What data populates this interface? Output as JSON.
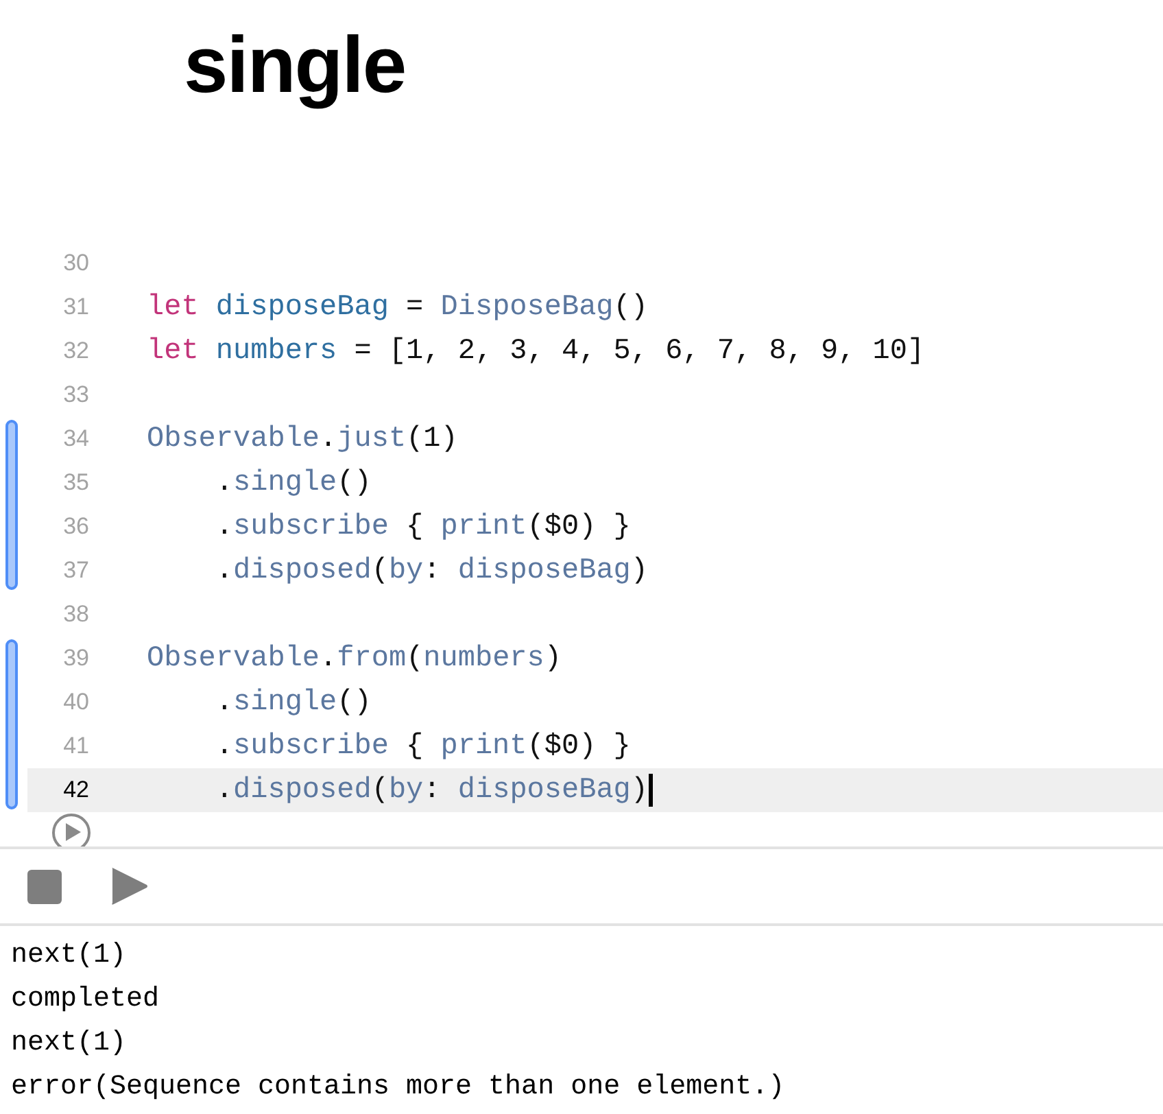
{
  "title": "single",
  "editor": {
    "blocks": [
      {
        "changed": false,
        "lines": [
          {
            "number": "30",
            "selected": false,
            "cursor": false
          },
          {
            "number": "31",
            "selected": false,
            "cursor": false,
            "tokens": [
              {
                "kind": "keyword",
                "text": "let "
              },
              {
                "kind": "decl",
                "text": "disposeBag"
              },
              {
                "kind": "plain",
                "text": " = "
              },
              {
                "kind": "call",
                "text": "DisposeBag"
              },
              {
                "kind": "plain",
                "text": "()"
              }
            ]
          },
          {
            "number": "32",
            "selected": false,
            "cursor": false,
            "tokens": [
              {
                "kind": "keyword",
                "text": "let "
              },
              {
                "kind": "decl",
                "text": "numbers"
              },
              {
                "kind": "plain",
                "text": " = [1, 2, 3, 4, 5, 6, 7, 8, 9, 10]"
              }
            ]
          },
          {
            "number": "33",
            "selected": false,
            "cursor": false
          }
        ]
      },
      {
        "changed": true,
        "lines": [
          {
            "number": "34",
            "selected": false,
            "cursor": false,
            "tokens": [
              {
                "kind": "call",
                "text": "Observable"
              },
              {
                "kind": "plain",
                "text": "."
              },
              {
                "kind": "call",
                "text": "just"
              },
              {
                "kind": "plain",
                "text": "(1)"
              }
            ]
          },
          {
            "number": "35",
            "selected": false,
            "cursor": false,
            "tokens": [
              {
                "kind": "plain",
                "text": "    ."
              },
              {
                "kind": "call",
                "text": "single"
              },
              {
                "kind": "plain",
                "text": "()"
              }
            ]
          },
          {
            "number": "36",
            "selected": false,
            "cursor": false,
            "tokens": [
              {
                "kind": "plain",
                "text": "    ."
              },
              {
                "kind": "call",
                "text": "subscribe"
              },
              {
                "kind": "plain",
                "text": " { "
              },
              {
                "kind": "call",
                "text": "print"
              },
              {
                "kind": "plain",
                "text": "($0) }"
              }
            ]
          },
          {
            "number": "37",
            "selected": false,
            "cursor": false,
            "tokens": [
              {
                "kind": "plain",
                "text": "    ."
              },
              {
                "kind": "call",
                "text": "disposed"
              },
              {
                "kind": "plain",
                "text": "("
              },
              {
                "kind": "call",
                "text": "by"
              },
              {
                "kind": "plain",
                "text": ": "
              },
              {
                "kind": "call",
                "text": "disposeBag"
              },
              {
                "kind": "plain",
                "text": ")"
              }
            ]
          }
        ]
      },
      {
        "changed": false,
        "lines": [
          {
            "number": "38",
            "selected": false,
            "cursor": false
          }
        ]
      },
      {
        "changed": true,
        "lines": [
          {
            "number": "39",
            "selected": false,
            "cursor": false,
            "tokens": [
              {
                "kind": "call",
                "text": "Observable"
              },
              {
                "kind": "plain",
                "text": "."
              },
              {
                "kind": "call",
                "text": "from"
              },
              {
                "kind": "plain",
                "text": "("
              },
              {
                "kind": "call",
                "text": "numbers"
              },
              {
                "kind": "plain",
                "text": ")"
              }
            ]
          },
          {
            "number": "40",
            "selected": false,
            "cursor": false,
            "tokens": [
              {
                "kind": "plain",
                "text": "    ."
              },
              {
                "kind": "call",
                "text": "single"
              },
              {
                "kind": "plain",
                "text": "()"
              }
            ]
          },
          {
            "number": "41",
            "selected": false,
            "cursor": false,
            "tokens": [
              {
                "kind": "plain",
                "text": "    ."
              },
              {
                "kind": "call",
                "text": "subscribe"
              },
              {
                "kind": "plain",
                "text": " { "
              },
              {
                "kind": "call",
                "text": "print"
              },
              {
                "kind": "plain",
                "text": "($0) }"
              }
            ]
          },
          {
            "number": "42",
            "selected": true,
            "cursor": true,
            "tokens": [
              {
                "kind": "plain",
                "text": "    ."
              },
              {
                "kind": "call",
                "text": "disposed"
              },
              {
                "kind": "plain",
                "text": "("
              },
              {
                "kind": "call",
                "text": "by"
              },
              {
                "kind": "plain",
                "text": ": "
              },
              {
                "kind": "call",
                "text": "disposeBag"
              },
              {
                "kind": "plain",
                "text": ")"
              }
            ]
          }
        ]
      }
    ]
  },
  "console": {
    "lines": [
      "next(1)",
      "completed",
      "next(1)",
      "error(Sequence contains more than one element.)"
    ]
  }
}
